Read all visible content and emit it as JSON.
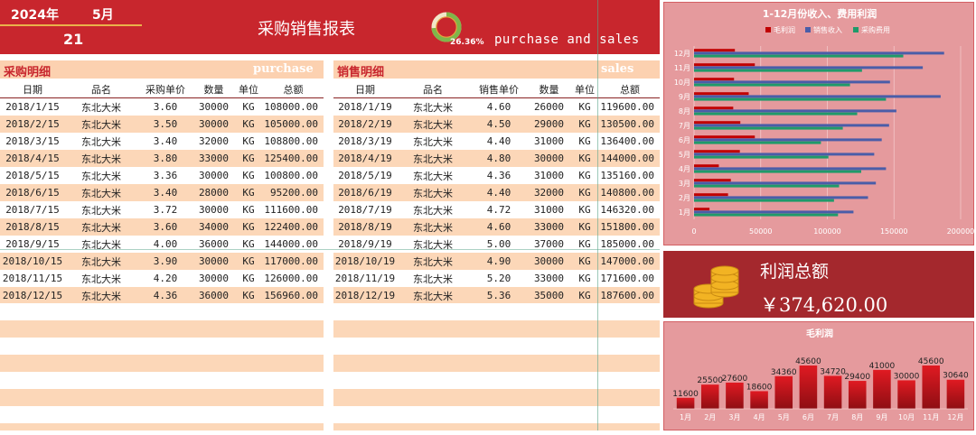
{
  "header": {
    "year": "2024年",
    "month": "5月",
    "day": "21",
    "title": "采购销售报表",
    "percent": "26.36%",
    "percent_value": 0.2636,
    "subtitle": "purchase and sales"
  },
  "purchase": {
    "label": "采购明细",
    "label_en": "purchase",
    "columns": [
      "日期",
      "品名",
      "采购单价",
      "数量",
      "单位",
      "总额"
    ],
    "rows": [
      [
        "2018/1/15",
        "东北大米",
        "3.60",
        "30000",
        "KG",
        "108000.00"
      ],
      [
        "2018/2/15",
        "东北大米",
        "3.50",
        "30000",
        "KG",
        "105000.00"
      ],
      [
        "2018/3/15",
        "东北大米",
        "3.40",
        "32000",
        "KG",
        "108800.00"
      ],
      [
        "2018/4/15",
        "东北大米",
        "3.80",
        "33000",
        "KG",
        "125400.00"
      ],
      [
        "2018/5/15",
        "东北大米",
        "3.36",
        "30000",
        "KG",
        "100800.00"
      ],
      [
        "2018/6/15",
        "东北大米",
        "3.40",
        "28000",
        "KG",
        "95200.00"
      ],
      [
        "2018/7/15",
        "东北大米",
        "3.72",
        "30000",
        "KG",
        "111600.00"
      ],
      [
        "2018/8/15",
        "东北大米",
        "3.60",
        "34000",
        "KG",
        "122400.00"
      ],
      [
        "2018/9/15",
        "东北大米",
        "4.00",
        "36000",
        "KG",
        "144000.00"
      ],
      [
        "2018/10/15",
        "东北大米",
        "3.90",
        "30000",
        "KG",
        "117000.00"
      ],
      [
        "2018/11/15",
        "东北大米",
        "4.20",
        "30000",
        "KG",
        "126000.00"
      ],
      [
        "2018/12/15",
        "东北大米",
        "4.36",
        "36000",
        "KG",
        "156960.00"
      ]
    ]
  },
  "sales": {
    "label": "销售明细",
    "label_en": "sales",
    "columns": [
      "日期",
      "品名",
      "销售单价",
      "数量",
      "单位",
      "总额"
    ],
    "rows": [
      [
        "2018/1/19",
        "东北大米",
        "4.60",
        "26000",
        "KG",
        "119600.00"
      ],
      [
        "2018/2/19",
        "东北大米",
        "4.50",
        "29000",
        "KG",
        "130500.00"
      ],
      [
        "2018/3/19",
        "东北大米",
        "4.40",
        "31000",
        "KG",
        "136400.00"
      ],
      [
        "2018/4/19",
        "东北大米",
        "4.80",
        "30000",
        "KG",
        "144000.00"
      ],
      [
        "2018/5/19",
        "东北大米",
        "4.36",
        "31000",
        "KG",
        "135160.00"
      ],
      [
        "2018/6/19",
        "东北大米",
        "4.40",
        "32000",
        "KG",
        "140800.00"
      ],
      [
        "2018/7/19",
        "东北大米",
        "4.72",
        "31000",
        "KG",
        "146320.00"
      ],
      [
        "2018/8/19",
        "东北大米",
        "4.60",
        "33000",
        "KG",
        "151800.00"
      ],
      [
        "2018/9/19",
        "东北大米",
        "5.00",
        "37000",
        "KG",
        "185000.00"
      ],
      [
        "2018/10/19",
        "东北大米",
        "4.90",
        "30000",
        "KG",
        "147000.00"
      ],
      [
        "2018/11/19",
        "东北大米",
        "5.20",
        "33000",
        "KG",
        "171600.00"
      ],
      [
        "2018/12/19",
        "东北大米",
        "5.36",
        "35000",
        "KG",
        "187600.00"
      ]
    ]
  },
  "profit_total": {
    "title": "利润总额",
    "value": "￥374,620.00"
  },
  "chart_data": [
    {
      "type": "bar",
      "orientation": "horizontal",
      "title": "1-12月份收入、费用利润",
      "categories": [
        "1月",
        "2月",
        "3月",
        "4月",
        "5月",
        "6月",
        "7月",
        "8月",
        "9月",
        "10月",
        "11月",
        "12月"
      ],
      "series": [
        {
          "name": "毛利润",
          "color": "#c00000",
          "values": [
            11600,
            25500,
            27600,
            18600,
            34360,
            45600,
            34720,
            29400,
            41000,
            30000,
            45600,
            30640
          ]
        },
        {
          "name": "销售收入",
          "color": "#4a5da8",
          "values": [
            119600,
            130500,
            136400,
            144000,
            135160,
            140800,
            146320,
            151800,
            185000,
            147000,
            171600,
            187600
          ]
        },
        {
          "name": "采购费用",
          "color": "#1f9a6a",
          "values": [
            108000,
            105000,
            108800,
            125400,
            100800,
            95200,
            111600,
            122400,
            144000,
            117000,
            126000,
            156960
          ]
        }
      ],
      "xlim": [
        0,
        200000
      ],
      "xticks": [
        "0",
        "50000",
        "100000",
        "150000",
        "200000"
      ],
      "legend": "top",
      "grid": true
    },
    {
      "type": "bar",
      "title": "毛利润",
      "categories": [
        "1月",
        "2月",
        "3月",
        "4月",
        "5月",
        "6月",
        "7月",
        "8月",
        "9月",
        "10月",
        "11月",
        "12月"
      ],
      "values": [
        11600,
        25500,
        27600,
        18600,
        34360,
        45600,
        34720,
        29400,
        41000,
        30000,
        45600,
        30640
      ],
      "color": "#d41920",
      "data_labels": true
    }
  ]
}
